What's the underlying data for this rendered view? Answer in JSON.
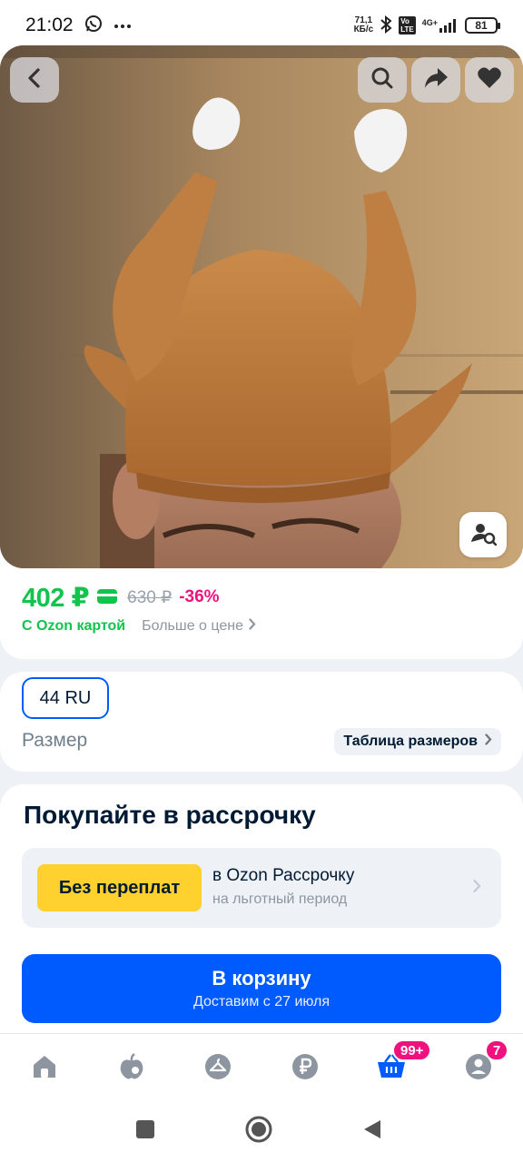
{
  "status_bar": {
    "time": "21:02",
    "net_speed_value": "71,1",
    "net_speed_unit": "КБ/с",
    "network_label": "4G+",
    "battery": "81"
  },
  "product": {
    "price": "402 ₽",
    "old_price": "630 ₽",
    "discount": "-36%",
    "card_label": "С Ozon картой",
    "more_price_label": "Больше о цене"
  },
  "size": {
    "selected": "44 RU",
    "label": "Размер",
    "table_label": "Таблица размеров"
  },
  "installment": {
    "title": "Покупайте в рассрочку",
    "badge": "Без переплат",
    "line1": "в Ozon Рассрочку",
    "line2": "на льготный период"
  },
  "cart": {
    "title": "В корзину",
    "subtitle": "Доставим с 27 июля"
  },
  "bottom_nav": {
    "cart_badge": "99+",
    "profile_badge": "7"
  },
  "colors": {
    "brand_blue": "#005bff",
    "price_green": "#10c44c",
    "discount_pink": "#f1117e",
    "installment_yellow": "#ffd12e"
  }
}
